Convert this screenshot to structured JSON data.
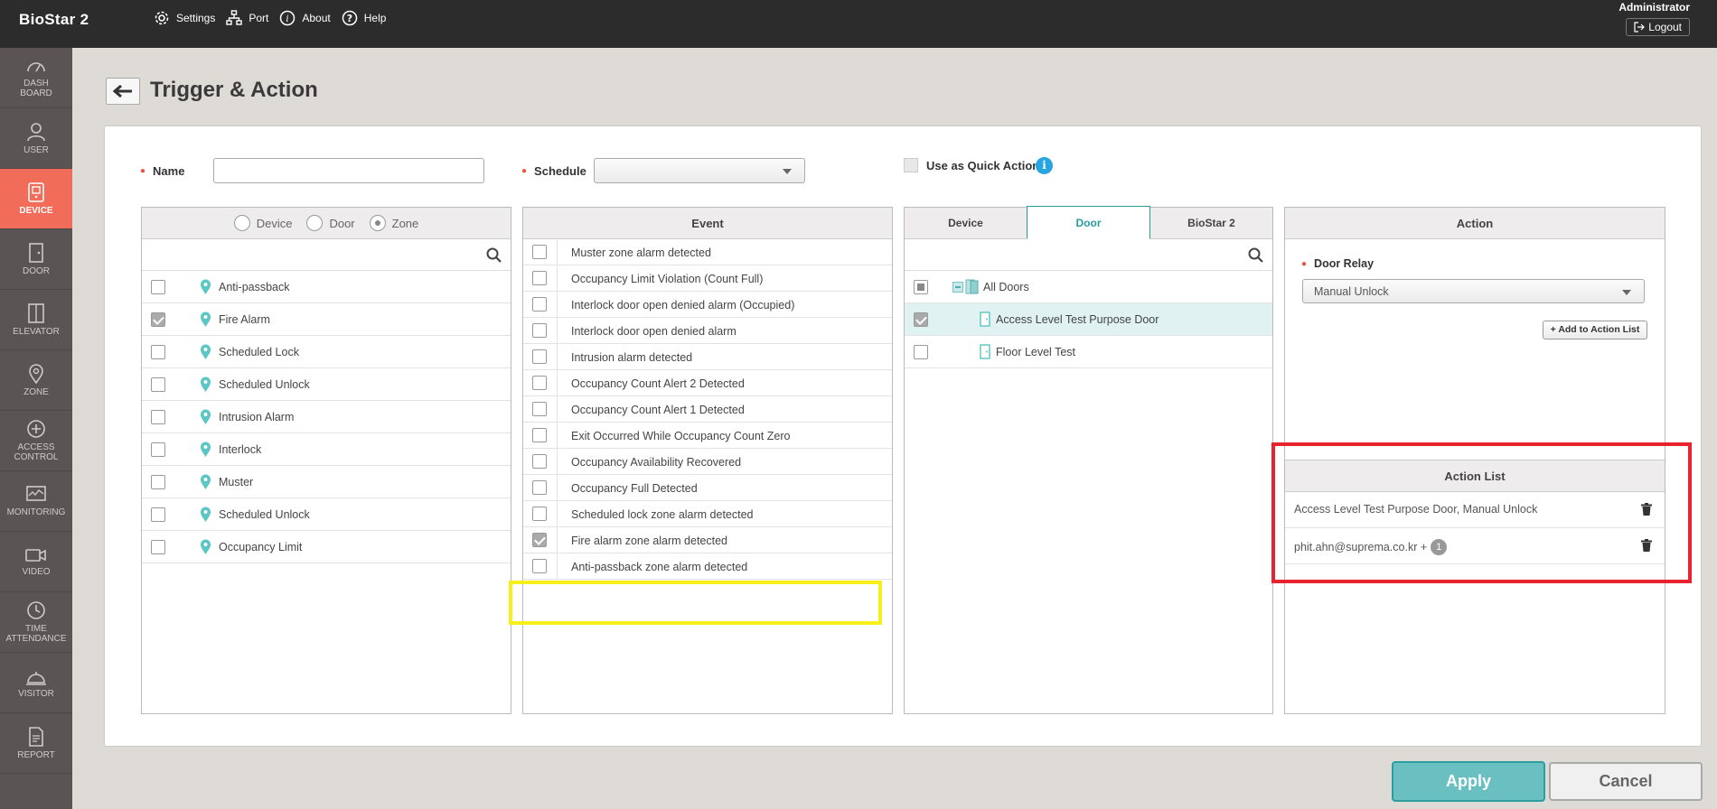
{
  "app": {
    "brand": "BioStar 2",
    "nav": [
      {
        "label": "Settings",
        "icon": "gear-icon"
      },
      {
        "label": "Port",
        "icon": "network-icon"
      },
      {
        "label": "About",
        "icon": "info-icon"
      },
      {
        "label": "Help",
        "icon": "help-icon"
      }
    ],
    "user": "Administrator",
    "logout_label": "Logout"
  },
  "sidebar": {
    "items": [
      {
        "label": "DASH BOARD",
        "icon": "dashboard-icon",
        "active": false
      },
      {
        "label": "USER",
        "icon": "user-icon",
        "active": false
      },
      {
        "label": "DEVICE",
        "icon": "device-icon",
        "active": true
      },
      {
        "label": "DOOR",
        "icon": "door-icon",
        "active": false
      },
      {
        "label": "ELEVATOR",
        "icon": "elevator-icon",
        "active": false
      },
      {
        "label": "ZONE",
        "icon": "zone-icon",
        "active": false
      },
      {
        "label": "ACCESS CONTROL",
        "icon": "access-control-icon",
        "active": false
      },
      {
        "label": "MONITORING",
        "icon": "monitoring-icon",
        "active": false
      },
      {
        "label": "VIDEO",
        "icon": "video-icon",
        "active": false
      },
      {
        "label": "TIME ATTENDANCE",
        "icon": "clock-icon",
        "active": false
      },
      {
        "label": "VISITOR",
        "icon": "visitor-icon",
        "active": false
      },
      {
        "label": "REPORT",
        "icon": "report-icon",
        "active": false
      }
    ]
  },
  "page": {
    "title": "Trigger & Action"
  },
  "form": {
    "name_label": "Name",
    "name_value": "",
    "schedule_label": "Schedule",
    "schedule_value": "",
    "quick_action_label": "Use as Quick Action",
    "quick_action_checked": false,
    "info_glyph": "i"
  },
  "zone_panel": {
    "radio_options": [
      {
        "label": "Device",
        "selected": false
      },
      {
        "label": "Door",
        "selected": false
      },
      {
        "label": "Zone",
        "selected": true
      }
    ],
    "items": [
      {
        "label": "Anti-passback",
        "checked": false
      },
      {
        "label": "Fire Alarm",
        "checked": true
      },
      {
        "label": "Scheduled Lock",
        "checked": false
      },
      {
        "label": "Scheduled Unlock",
        "checked": false
      },
      {
        "label": "Intrusion Alarm",
        "checked": false
      },
      {
        "label": "Interlock",
        "checked": false
      },
      {
        "label": "Muster",
        "checked": false
      },
      {
        "label": "Scheduled Unlock",
        "checked": false
      },
      {
        "label": "Occupancy Limit",
        "checked": false
      }
    ]
  },
  "event_panel": {
    "header": "Event",
    "items": [
      {
        "label": "Muster zone alarm detected",
        "checked": false
      },
      {
        "label": "Occupancy Limit Violation (Count Full)",
        "checked": false
      },
      {
        "label": "Interlock door open denied alarm (Occupied)",
        "checked": false
      },
      {
        "label": "Interlock door open denied alarm",
        "checked": false
      },
      {
        "label": "Intrusion alarm detected",
        "checked": false
      },
      {
        "label": "Occupancy Count Alert 2 Detected",
        "checked": false
      },
      {
        "label": "Occupancy Count Alert 1 Detected",
        "checked": false
      },
      {
        "label": "Exit Occurred While Occupancy Count Zero",
        "checked": false
      },
      {
        "label": "Occupancy Availability Recovered",
        "checked": false
      },
      {
        "label": "Occupancy Full Detected",
        "checked": false
      },
      {
        "label": "Scheduled lock zone alarm detected",
        "checked": false
      },
      {
        "label": "Fire alarm zone alarm detected",
        "checked": true
      },
      {
        "label": "Anti-passback zone alarm detected",
        "checked": false
      }
    ]
  },
  "door_panel": {
    "tabs": [
      {
        "label": "Device",
        "active": false
      },
      {
        "label": "Door",
        "active": true
      },
      {
        "label": "BioStar 2",
        "active": false
      }
    ],
    "all_label": "All Doors",
    "items": [
      {
        "label": "Access Level Test Purpose Door",
        "checked": true
      },
      {
        "label": "Floor Level Test",
        "checked": false
      }
    ]
  },
  "action_panel": {
    "header": "Action",
    "door_relay_label": "Door Relay",
    "door_relay_value": "Manual Unlock",
    "add_button": "+ Add to Action List",
    "action_list_header": "Action List",
    "action_list": [
      {
        "label": "Access Level Test Purpose Door, Manual Unlock"
      },
      {
        "label": "phit.ahn@suprema.co.kr +",
        "count": "1"
      }
    ]
  },
  "buttons": {
    "apply": "Apply",
    "cancel": "Cancel"
  },
  "colors": {
    "accent_teal": "#2a9b9b",
    "active_sidebar": "#f26c5a",
    "highlight_yellow": "#f7ef1a",
    "highlight_red": "#e8232d"
  }
}
